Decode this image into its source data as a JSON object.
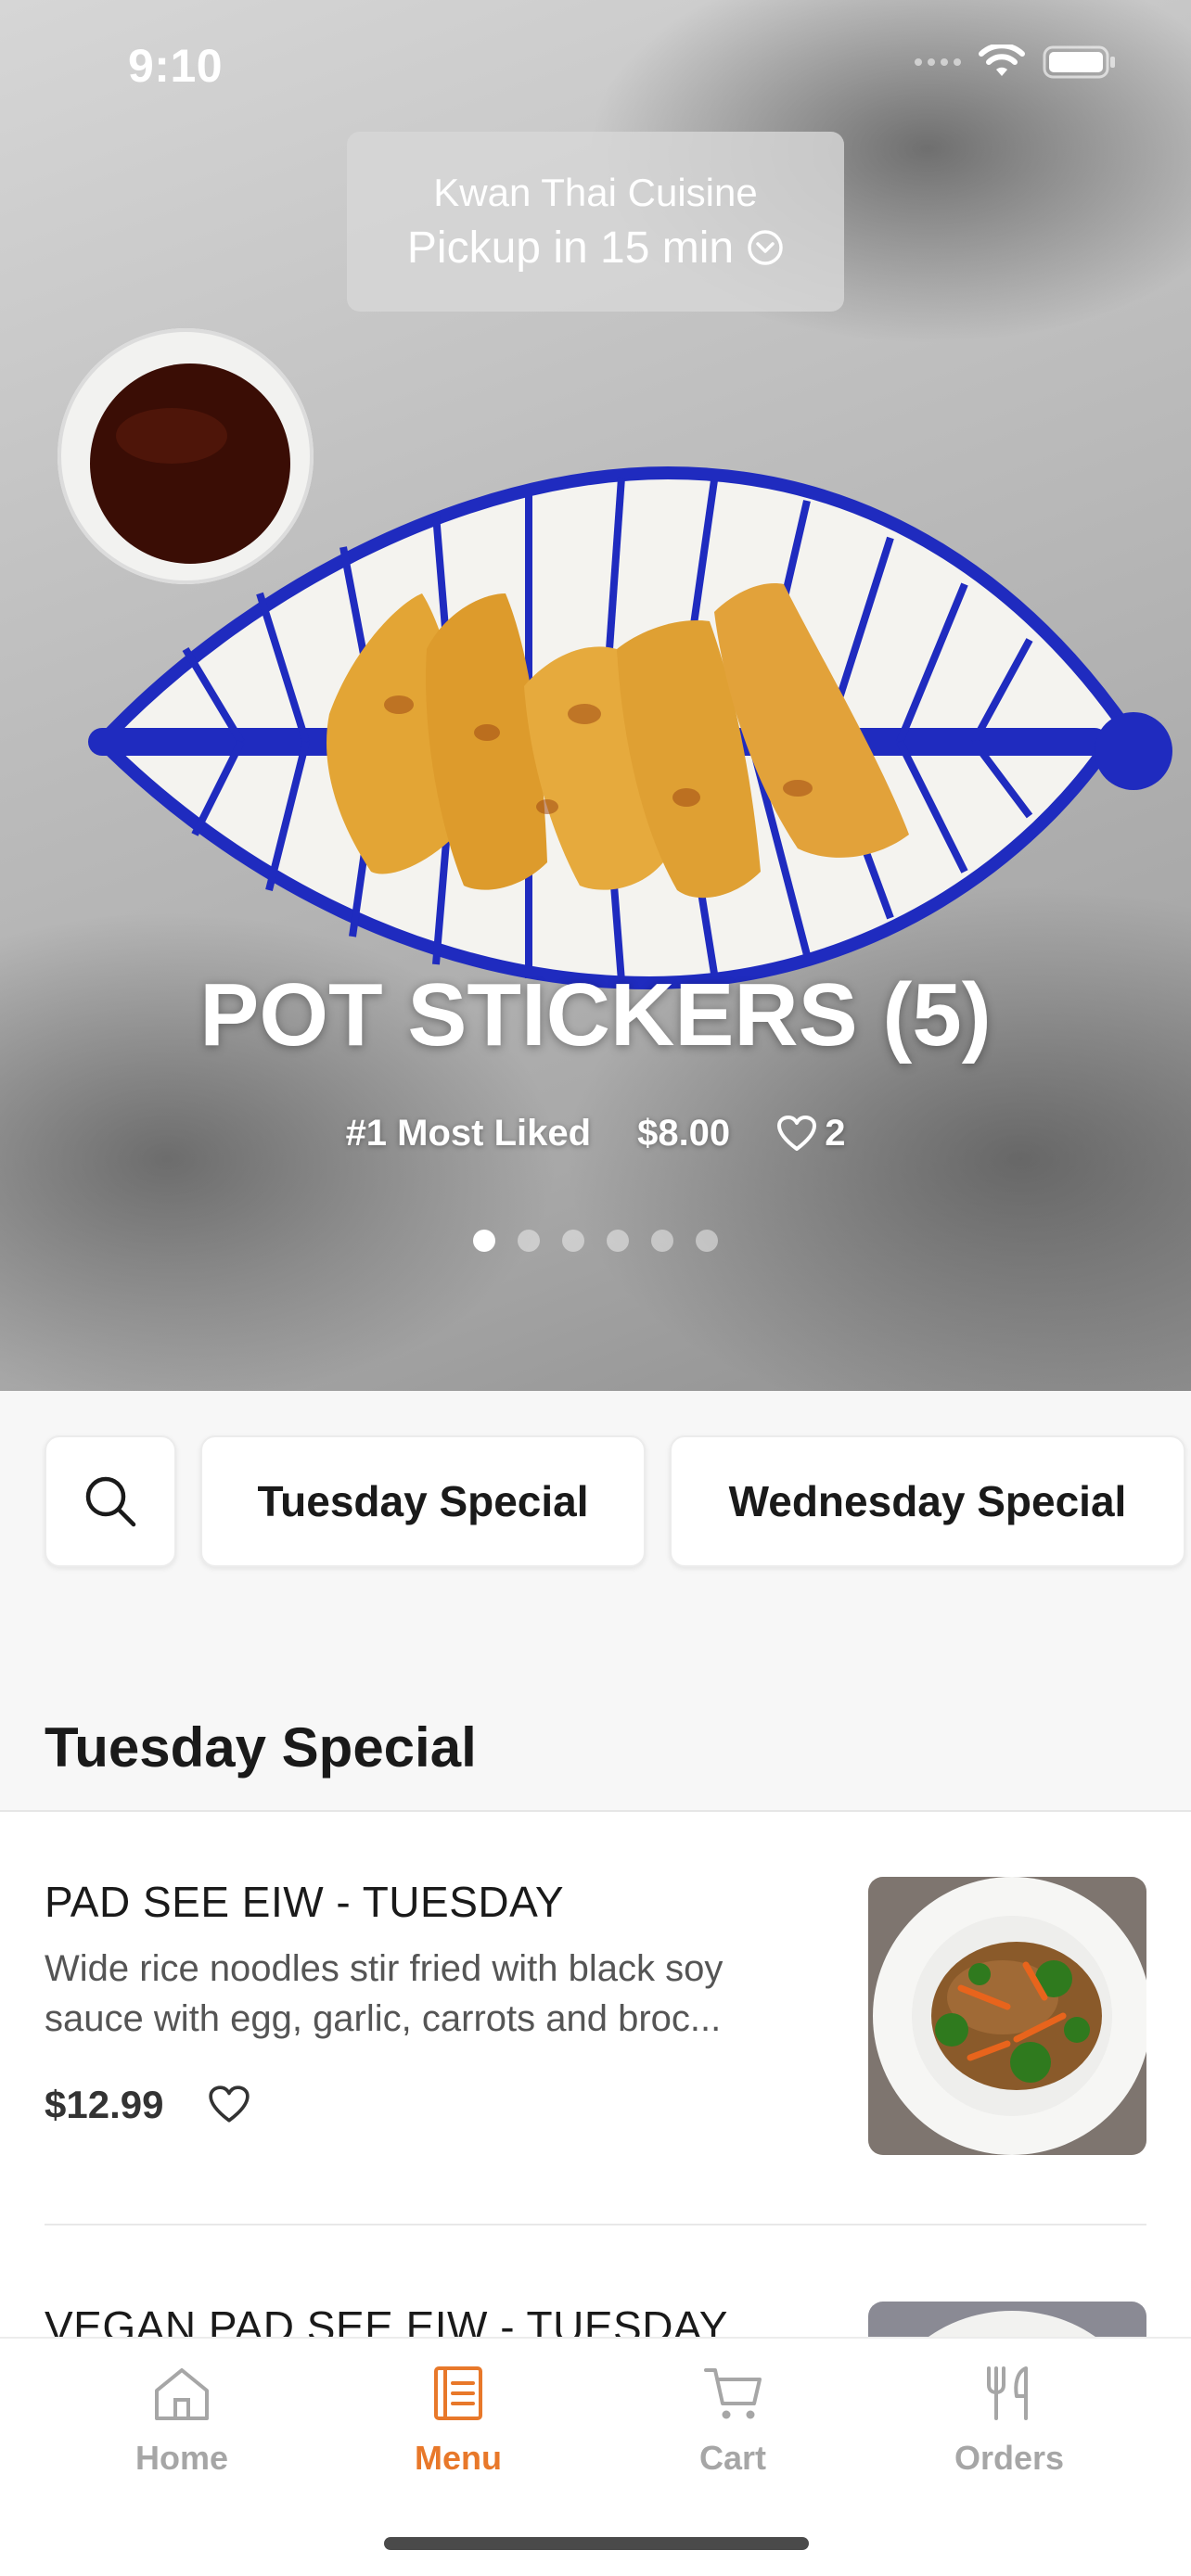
{
  "status_bar": {
    "time": "9:10",
    "icons": [
      "signal-dots-icon",
      "wifi-icon",
      "battery-icon"
    ]
  },
  "store": {
    "name": "Kwan Thai Cuisine",
    "pickup_label": "Pickup in 15 min",
    "chevron_icon": "chevron-down-circle-icon"
  },
  "hero": {
    "title": "POT STICKERS (5)",
    "rank_label": "#1 Most Liked",
    "price": "$8.00",
    "likes": "2",
    "carousel": {
      "total": 6,
      "active_index": 0
    }
  },
  "chips": {
    "search_icon": "search-icon",
    "items": [
      "Tuesday Special",
      "Wednesday Special"
    ]
  },
  "section": {
    "title": "Tuesday Special"
  },
  "menu_items": [
    {
      "name": "PAD SEE EIW - TUESDAY",
      "description_line1": "Wide rice noodles stir fried with black soy",
      "description_line2": "sauce with egg, garlic, carrots and broc...",
      "price": "$12.99",
      "favorite_icon": "heart-outline-icon"
    },
    {
      "name": "VEGAN PAD SEE EIW - TUESDAY"
    }
  ],
  "tabbar": {
    "tabs": [
      {
        "label": "Home",
        "icon": "home-icon",
        "active": false
      },
      {
        "label": "Menu",
        "icon": "menu-book-icon",
        "active": true
      },
      {
        "label": "Cart",
        "icon": "cart-icon",
        "active": false
      },
      {
        "label": "Orders",
        "icon": "fork-knife-icon",
        "active": false
      }
    ]
  },
  "colors": {
    "accent": "#e8782a",
    "inactive_tab": "#a6a6a6",
    "plate_blue": "#1f2bbf",
    "dumpling": "#e3a535"
  }
}
